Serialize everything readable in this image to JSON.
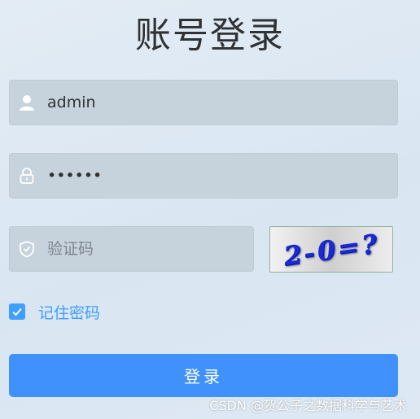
{
  "title": "账号登录",
  "username": {
    "value": "admin",
    "placeholder": "",
    "icon": "user-icon"
  },
  "password": {
    "value": "aaaaaa",
    "placeholder": "",
    "icon": "lock-icon"
  },
  "captcha_field": {
    "value": "",
    "placeholder": "验证码",
    "icon": "shield-icon"
  },
  "captcha_image": {
    "text": "2-0=?"
  },
  "remember": {
    "label": "记住密码",
    "checked": true
  },
  "login_button": {
    "label": "登录"
  },
  "watermark": "CSDN @贺公子之数据科学与艺术",
  "colors": {
    "accent": "#409eff",
    "button": "#4191fd",
    "field_bg": "#c6d2dc",
    "title": "#303133"
  }
}
